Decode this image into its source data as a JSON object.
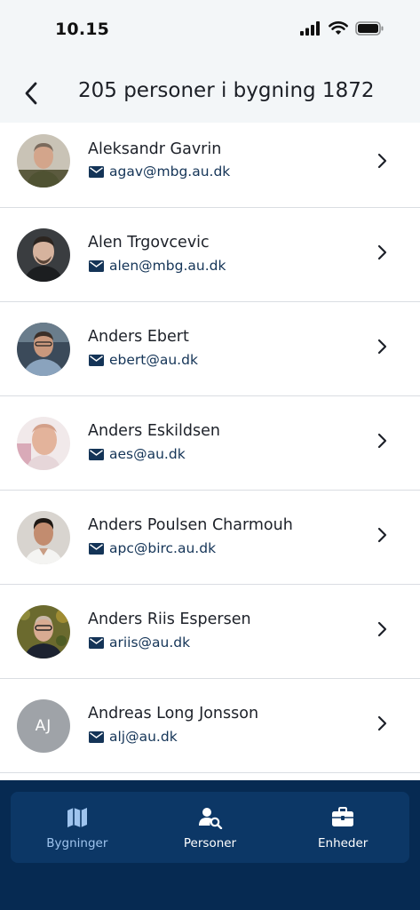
{
  "status_bar": {
    "time": "10.15"
  },
  "header": {
    "title": "205 personer i bygning 1872"
  },
  "people": [
    {
      "name": "Aleksandr Gavrin",
      "email": "agav@mbg.au.dk",
      "avatar": "photo"
    },
    {
      "name": "Alen Trgovcevic",
      "email": "alen@mbg.au.dk",
      "avatar": "photo"
    },
    {
      "name": "Anders Ebert",
      "email": "ebert@au.dk",
      "avatar": "photo"
    },
    {
      "name": "Anders Eskildsen",
      "email": "aes@au.dk",
      "avatar": "photo"
    },
    {
      "name": "Anders Poulsen Charmouh",
      "email": "apc@birc.au.dk",
      "avatar": "photo"
    },
    {
      "name": "Anders Riis Espersen",
      "email": "ariis@au.dk",
      "avatar": "photo"
    },
    {
      "name": "Andreas Long Jonsson",
      "email": "alj@au.dk",
      "avatar": "initials",
      "initials": "AJ"
    }
  ],
  "tabbar": {
    "tabs": [
      {
        "label": "Bygninger",
        "icon": "map-icon",
        "active": true
      },
      {
        "label": "Personer",
        "icon": "person-search-icon",
        "active": false
      },
      {
        "label": "Enheder",
        "icon": "briefcase-icon",
        "active": false
      }
    ]
  },
  "colors": {
    "accent": "#143457",
    "tabbar_bg": "#0c3766",
    "bottom_bg": "#062a52",
    "active_tab": "#9fc4ee"
  }
}
